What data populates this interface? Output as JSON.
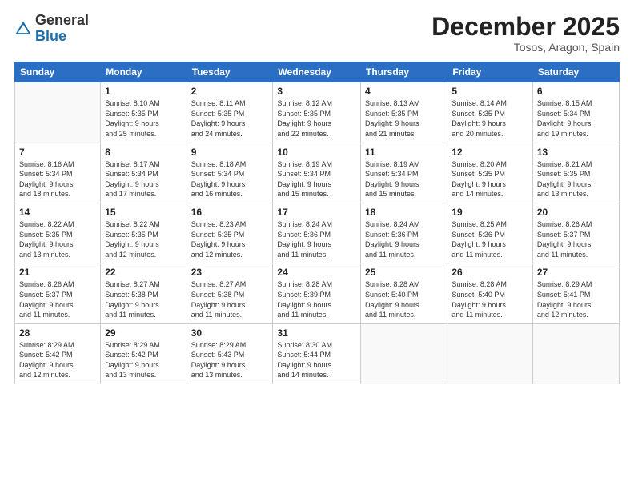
{
  "header": {
    "logo_general": "General",
    "logo_blue": "Blue",
    "month": "December 2025",
    "location": "Tosos, Aragon, Spain"
  },
  "days_of_week": [
    "Sunday",
    "Monday",
    "Tuesday",
    "Wednesday",
    "Thursday",
    "Friday",
    "Saturday"
  ],
  "weeks": [
    [
      {
        "day": "",
        "info": ""
      },
      {
        "day": "1",
        "info": "Sunrise: 8:10 AM\nSunset: 5:35 PM\nDaylight: 9 hours\nand 25 minutes."
      },
      {
        "day": "2",
        "info": "Sunrise: 8:11 AM\nSunset: 5:35 PM\nDaylight: 9 hours\nand 24 minutes."
      },
      {
        "day": "3",
        "info": "Sunrise: 8:12 AM\nSunset: 5:35 PM\nDaylight: 9 hours\nand 22 minutes."
      },
      {
        "day": "4",
        "info": "Sunrise: 8:13 AM\nSunset: 5:35 PM\nDaylight: 9 hours\nand 21 minutes."
      },
      {
        "day": "5",
        "info": "Sunrise: 8:14 AM\nSunset: 5:35 PM\nDaylight: 9 hours\nand 20 minutes."
      },
      {
        "day": "6",
        "info": "Sunrise: 8:15 AM\nSunset: 5:34 PM\nDaylight: 9 hours\nand 19 minutes."
      }
    ],
    [
      {
        "day": "7",
        "info": "Sunrise: 8:16 AM\nSunset: 5:34 PM\nDaylight: 9 hours\nand 18 minutes."
      },
      {
        "day": "8",
        "info": "Sunrise: 8:17 AM\nSunset: 5:34 PM\nDaylight: 9 hours\nand 17 minutes."
      },
      {
        "day": "9",
        "info": "Sunrise: 8:18 AM\nSunset: 5:34 PM\nDaylight: 9 hours\nand 16 minutes."
      },
      {
        "day": "10",
        "info": "Sunrise: 8:19 AM\nSunset: 5:34 PM\nDaylight: 9 hours\nand 15 minutes."
      },
      {
        "day": "11",
        "info": "Sunrise: 8:19 AM\nSunset: 5:34 PM\nDaylight: 9 hours\nand 15 minutes."
      },
      {
        "day": "12",
        "info": "Sunrise: 8:20 AM\nSunset: 5:35 PM\nDaylight: 9 hours\nand 14 minutes."
      },
      {
        "day": "13",
        "info": "Sunrise: 8:21 AM\nSunset: 5:35 PM\nDaylight: 9 hours\nand 13 minutes."
      }
    ],
    [
      {
        "day": "14",
        "info": "Sunrise: 8:22 AM\nSunset: 5:35 PM\nDaylight: 9 hours\nand 13 minutes."
      },
      {
        "day": "15",
        "info": "Sunrise: 8:22 AM\nSunset: 5:35 PM\nDaylight: 9 hours\nand 12 minutes."
      },
      {
        "day": "16",
        "info": "Sunrise: 8:23 AM\nSunset: 5:35 PM\nDaylight: 9 hours\nand 12 minutes."
      },
      {
        "day": "17",
        "info": "Sunrise: 8:24 AM\nSunset: 5:36 PM\nDaylight: 9 hours\nand 11 minutes."
      },
      {
        "day": "18",
        "info": "Sunrise: 8:24 AM\nSunset: 5:36 PM\nDaylight: 9 hours\nand 11 minutes."
      },
      {
        "day": "19",
        "info": "Sunrise: 8:25 AM\nSunset: 5:36 PM\nDaylight: 9 hours\nand 11 minutes."
      },
      {
        "day": "20",
        "info": "Sunrise: 8:26 AM\nSunset: 5:37 PM\nDaylight: 9 hours\nand 11 minutes."
      }
    ],
    [
      {
        "day": "21",
        "info": "Sunrise: 8:26 AM\nSunset: 5:37 PM\nDaylight: 9 hours\nand 11 minutes."
      },
      {
        "day": "22",
        "info": "Sunrise: 8:27 AM\nSunset: 5:38 PM\nDaylight: 9 hours\nand 11 minutes."
      },
      {
        "day": "23",
        "info": "Sunrise: 8:27 AM\nSunset: 5:38 PM\nDaylight: 9 hours\nand 11 minutes."
      },
      {
        "day": "24",
        "info": "Sunrise: 8:28 AM\nSunset: 5:39 PM\nDaylight: 9 hours\nand 11 minutes."
      },
      {
        "day": "25",
        "info": "Sunrise: 8:28 AM\nSunset: 5:40 PM\nDaylight: 9 hours\nand 11 minutes."
      },
      {
        "day": "26",
        "info": "Sunrise: 8:28 AM\nSunset: 5:40 PM\nDaylight: 9 hours\nand 11 minutes."
      },
      {
        "day": "27",
        "info": "Sunrise: 8:29 AM\nSunset: 5:41 PM\nDaylight: 9 hours\nand 12 minutes."
      }
    ],
    [
      {
        "day": "28",
        "info": "Sunrise: 8:29 AM\nSunset: 5:42 PM\nDaylight: 9 hours\nand 12 minutes."
      },
      {
        "day": "29",
        "info": "Sunrise: 8:29 AM\nSunset: 5:42 PM\nDaylight: 9 hours\nand 13 minutes."
      },
      {
        "day": "30",
        "info": "Sunrise: 8:29 AM\nSunset: 5:43 PM\nDaylight: 9 hours\nand 13 minutes."
      },
      {
        "day": "31",
        "info": "Sunrise: 8:30 AM\nSunset: 5:44 PM\nDaylight: 9 hours\nand 14 minutes."
      },
      {
        "day": "",
        "info": ""
      },
      {
        "day": "",
        "info": ""
      },
      {
        "day": "",
        "info": ""
      }
    ]
  ]
}
